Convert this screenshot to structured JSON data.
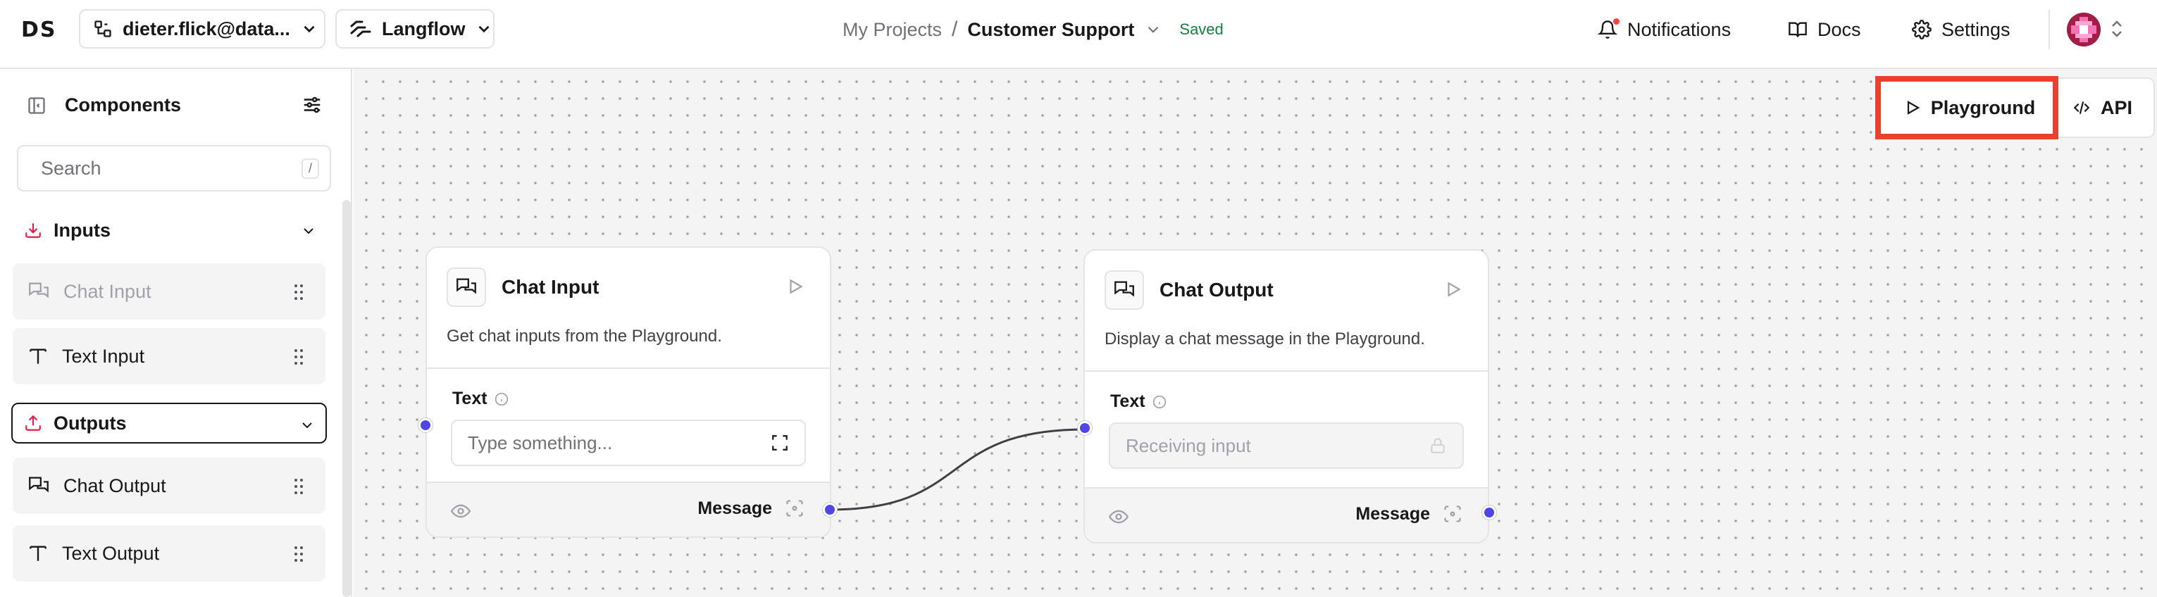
{
  "header": {
    "logo": "DS",
    "account": "dieter.flick@data...",
    "org": "Langflow",
    "breadcrumb": {
      "projects": "My Projects",
      "separator": "/",
      "flow": "Customer Support",
      "status": "Saved"
    },
    "notifications": "Notifications",
    "docs": "Docs",
    "settings": "Settings",
    "status_color": "#15803d"
  },
  "sidebar": {
    "title": "Components",
    "search": {
      "placeholder": "Search",
      "shortcut": "/"
    },
    "sections": [
      {
        "label": "Inputs",
        "items": [
          {
            "label": "Chat Input",
            "icon": "chat-icon",
            "disabled": true
          },
          {
            "label": "Text Input",
            "icon": "text-icon"
          }
        ]
      },
      {
        "label": "Outputs",
        "items": [
          {
            "label": "Chat Output",
            "icon": "chat-icon"
          },
          {
            "label": "Text Output",
            "icon": "text-icon"
          }
        ]
      }
    ]
  },
  "canvas": {
    "actions": {
      "playground": "Playground",
      "api": "API"
    },
    "highlight_color": "#e84130",
    "handle_color": "#4f46e5",
    "nodes": [
      {
        "title": "Chat Input",
        "description": "Get chat inputs from the Playground.",
        "field_label": "Text",
        "field_placeholder": "Type something...",
        "output_label": "Message"
      },
      {
        "title": "Chat Output",
        "description": "Display a chat message in the Playground.",
        "field_label": "Text",
        "field_placeholder": "Receiving input",
        "output_label": "Message"
      }
    ]
  }
}
